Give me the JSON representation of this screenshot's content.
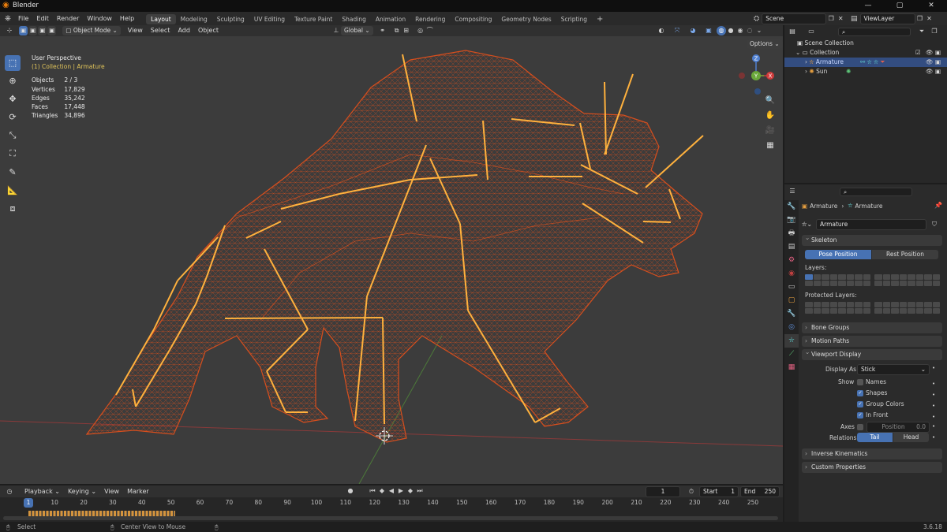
{
  "app": {
    "title": "Blender",
    "version": "3.6.18"
  },
  "menu": [
    "File",
    "Edit",
    "Render",
    "Window",
    "Help"
  ],
  "workspaces": [
    "Layout",
    "Modeling",
    "Sculpting",
    "UV Editing",
    "Texture Paint",
    "Shading",
    "Animation",
    "Rendering",
    "Compositing",
    "Geometry Nodes",
    "Scripting"
  ],
  "active_workspace": "Layout",
  "scene": "Scene",
  "view_layer": "ViewLayer",
  "viewport_header": {
    "mode": "Object Mode",
    "menus": [
      "View",
      "Select",
      "Add",
      "Object"
    ],
    "orientation": "Global",
    "options": "Options"
  },
  "viewport": {
    "perspective": "User Perspective",
    "collection_path": "(1) Collection | Armature",
    "stats": [
      {
        "label": "Objects",
        "value": "2 / 3"
      },
      {
        "label": "Vertices",
        "value": "17,829"
      },
      {
        "label": "Edges",
        "value": "35,242"
      },
      {
        "label": "Faces",
        "value": "17,448"
      },
      {
        "label": "Triangles",
        "value": "34,896"
      }
    ],
    "gizmo": {
      "x": "X",
      "y": "Y",
      "z": "Z"
    }
  },
  "outliner": {
    "root": "Scene Collection",
    "collection": "Collection",
    "items": [
      "Armature",
      "Sun"
    ]
  },
  "properties": {
    "breadcrumb_a": "Armature",
    "breadcrumb_b": "Armature",
    "name": "Armature",
    "skeleton": {
      "title": "Skeleton",
      "pose_position": "Pose Position",
      "rest_position": "Rest Position",
      "layers": "Layers:",
      "protected_layers": "Protected Layers:"
    },
    "bone_groups": "Bone Groups",
    "motion_paths": "Motion Paths",
    "viewport_display": {
      "title": "Viewport Display",
      "display_as_label": "Display As",
      "display_as": "Stick",
      "show_label": "Show",
      "names": "Names",
      "shapes": "Shapes",
      "group_colors": "Group Colors",
      "in_front": "In Front",
      "axes_label": "Axes",
      "position_label": "Position",
      "position_value": "0.0",
      "relations_label": "Relations",
      "tail": "Tail",
      "head": "Head"
    },
    "inverse_kinematics": "Inverse Kinematics",
    "custom_properties": "Custom Properties"
  },
  "timeline": {
    "menus": [
      "Playback",
      "Keying",
      "View",
      "Marker"
    ],
    "current_frame": "1",
    "start_label": "Start",
    "start": "1",
    "end_label": "End",
    "end": "250",
    "ticks": [
      "1",
      "10",
      "20",
      "30",
      "40",
      "50",
      "60",
      "70",
      "80",
      "90",
      "100",
      "110",
      "120",
      "130",
      "140",
      "150",
      "160",
      "170",
      "180",
      "190",
      "200",
      "210",
      "220",
      "230",
      "240",
      "250"
    ]
  },
  "status": {
    "select": "Select",
    "center_view": "Center View to Mouse"
  },
  "colors": {
    "accent": "#4772b3",
    "bone": "#ffb13d",
    "mesh": "#e0501c",
    "viewport_bg": "#3c3c3c"
  }
}
